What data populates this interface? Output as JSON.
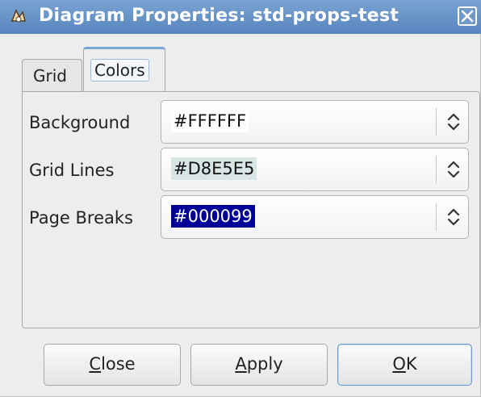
{
  "window": {
    "title": "Diagram Properties: std-props-test",
    "app_icon": "dia-app-icon",
    "close_icon": "close-icon"
  },
  "tabs": [
    {
      "label": "Grid",
      "active": false
    },
    {
      "label": "Colors",
      "active": true
    }
  ],
  "colors": {
    "rows": [
      {
        "label": "Background",
        "value": "#FFFFFF",
        "swatch": "#FFFFFF",
        "text_color": "#111111"
      },
      {
        "label": "Grid Lines",
        "value": "#D8E5E5",
        "swatch": "#D8E5E5",
        "text_color": "#111111"
      },
      {
        "label": "Page Breaks",
        "value": "#000099",
        "swatch": "#000099",
        "text_color": "#FFFFFF"
      }
    ],
    "dropdown_icon": "up-down-arrows-icon"
  },
  "buttons": {
    "close": {
      "mnemonic": "C",
      "rest": "lose"
    },
    "apply": {
      "mnemonic": "A",
      "rest": "pply"
    },
    "ok": {
      "mnemonic": "O",
      "rest": "K"
    }
  },
  "theme": {
    "titlebar": "#5684BD",
    "tab_accent": "#7AA6D6"
  }
}
